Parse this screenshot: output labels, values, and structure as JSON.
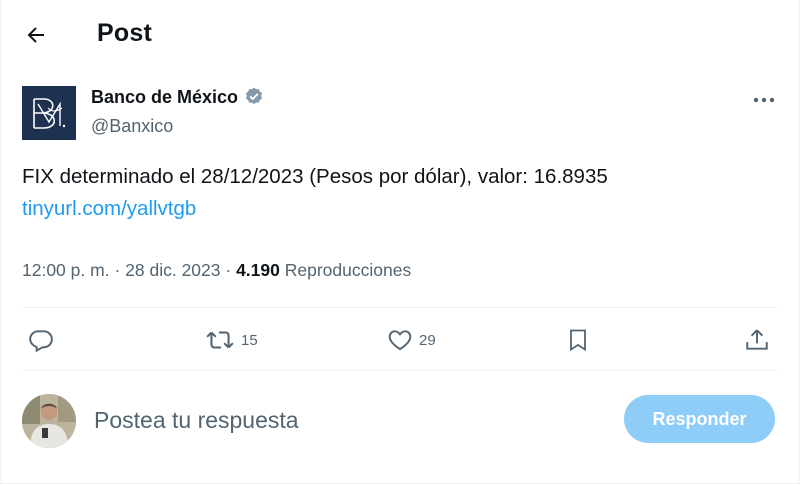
{
  "header": {
    "title": "Post",
    "back_icon": "arrow-left-icon"
  },
  "author": {
    "name": "Banco de México",
    "handle": "@Banxico",
    "verified": true,
    "avatar_logo_text": "B",
    "avatar_bg": "#1f3150"
  },
  "tweet": {
    "text": "FIX determinado el 28/12/2023 (Pesos por dólar), valor: 16.8935",
    "link": "tinyurl.com/yallvtgb"
  },
  "meta": {
    "time": "12:00 p. m.",
    "date": "28 dic. 2023",
    "views": "4.190",
    "views_label": "Reproducciones"
  },
  "actions": {
    "reply_count": "",
    "retweet_count": "15",
    "like_count": "29"
  },
  "reply_box": {
    "placeholder": "Postea tu respuesta",
    "button_label": "Responder"
  },
  "colors": {
    "accent": "#1d9bf0",
    "reply_button": "#8ecdf8",
    "secondary_text": "#536471",
    "verified_badge": "#829aab"
  }
}
